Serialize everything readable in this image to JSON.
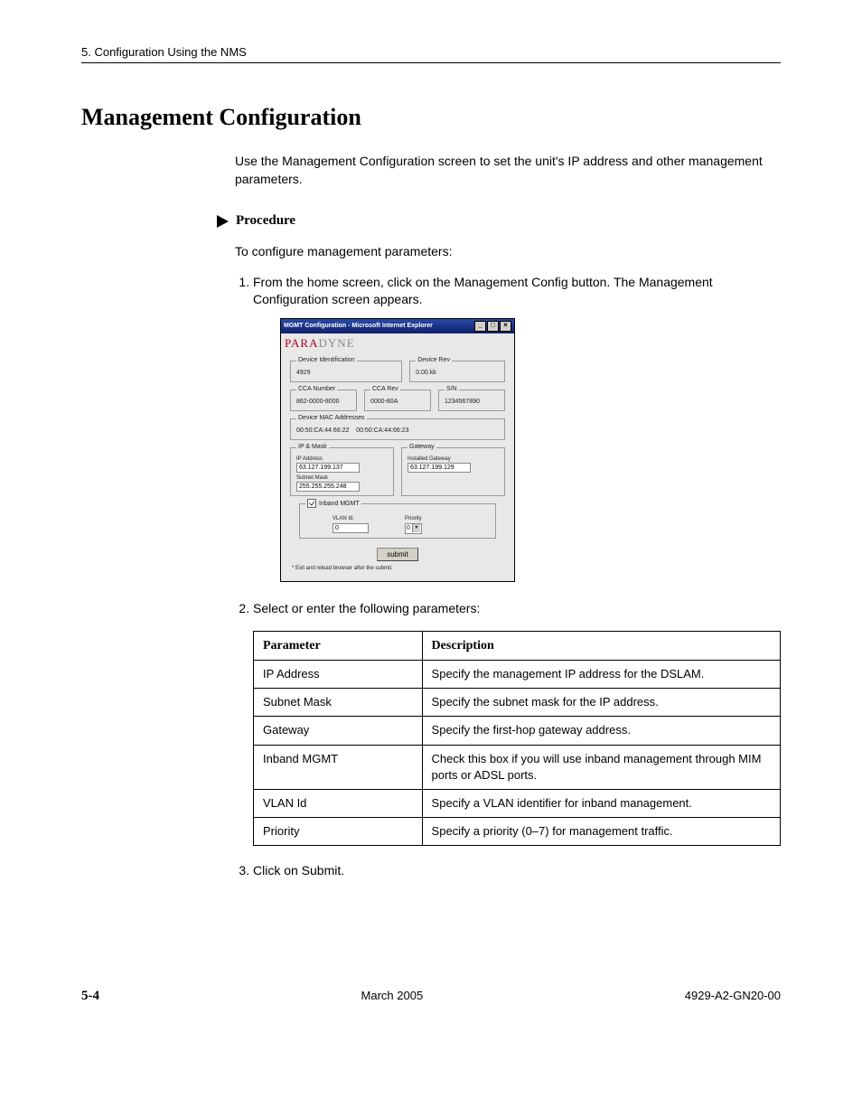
{
  "header": {
    "chapter": "5. Configuration Using the NMS"
  },
  "title": "Management Configuration",
  "intro": "Use the Management Configuration screen to set the unit's IP address and other management parameters.",
  "procedure_label": "Procedure",
  "procedure_intro": "To configure management parameters:",
  "steps": {
    "s1": "From the home screen, click on the Management Config button. The Management Configuration screen appears.",
    "s2": "Select or enter the following parameters:",
    "s3": "Click on Submit."
  },
  "screenshot": {
    "titlebar": "MGMT Configuration - Microsoft Internet Explorer",
    "brand_a": "PARA",
    "brand_b": "DYNE",
    "dev_id_label": "Device Identification",
    "dev_id_value": "4929",
    "dev_rev_label": "Device Rev",
    "dev_rev_value": "0.00.kk",
    "cca_num_label": "CCA Number",
    "cca_num_value": "862-0000-8000",
    "cca_rev_label": "CCA Rev",
    "cca_rev_value": "0000-80A",
    "sn_label": "S/N",
    "sn_value": "1234567890",
    "mac_label": "Device MAC Addresses",
    "mac1": "00:50:CA:44:66:22",
    "mac2": "00:50:CA:44:66:23",
    "ipmask_label": "IP & Mask",
    "ipaddr_label": "IP Address",
    "ipaddr_value": "63.127.199.137",
    "subnet_label": "Subnet Mask",
    "subnet_value": "255.255.255.248",
    "gateway_label": "Gateway",
    "inst_gw_label": "Installed Gateway",
    "inst_gw_value": "63.127.199.129",
    "inband_label": "Inband MGMT",
    "vlan_label": "VLAN Id.",
    "vlan_value": "0",
    "priority_label": "Priority",
    "priority_value": "0",
    "submit": "submit",
    "note": "* Exit and reload browser after the submit."
  },
  "table": {
    "h1": "Parameter",
    "h2": "Description",
    "rows": [
      {
        "p": "IP Address",
        "d": "Specify the management IP address for the DSLAM."
      },
      {
        "p": "Subnet Mask",
        "d": "Specify the subnet mask for the IP address."
      },
      {
        "p": "Gateway",
        "d": "Specify the first-hop gateway address."
      },
      {
        "p": "Inband MGMT",
        "d": "Check this box if you will use inband management through MIM ports or ADSL ports."
      },
      {
        "p": "VLAN Id",
        "d": "Specify a VLAN identifier for inband management."
      },
      {
        "p": "Priority",
        "d": "Specify a priority (0–7) for management traffic."
      }
    ]
  },
  "footer": {
    "page": "5-4",
    "date": "March 2005",
    "doc": "4929-A2-GN20-00"
  }
}
